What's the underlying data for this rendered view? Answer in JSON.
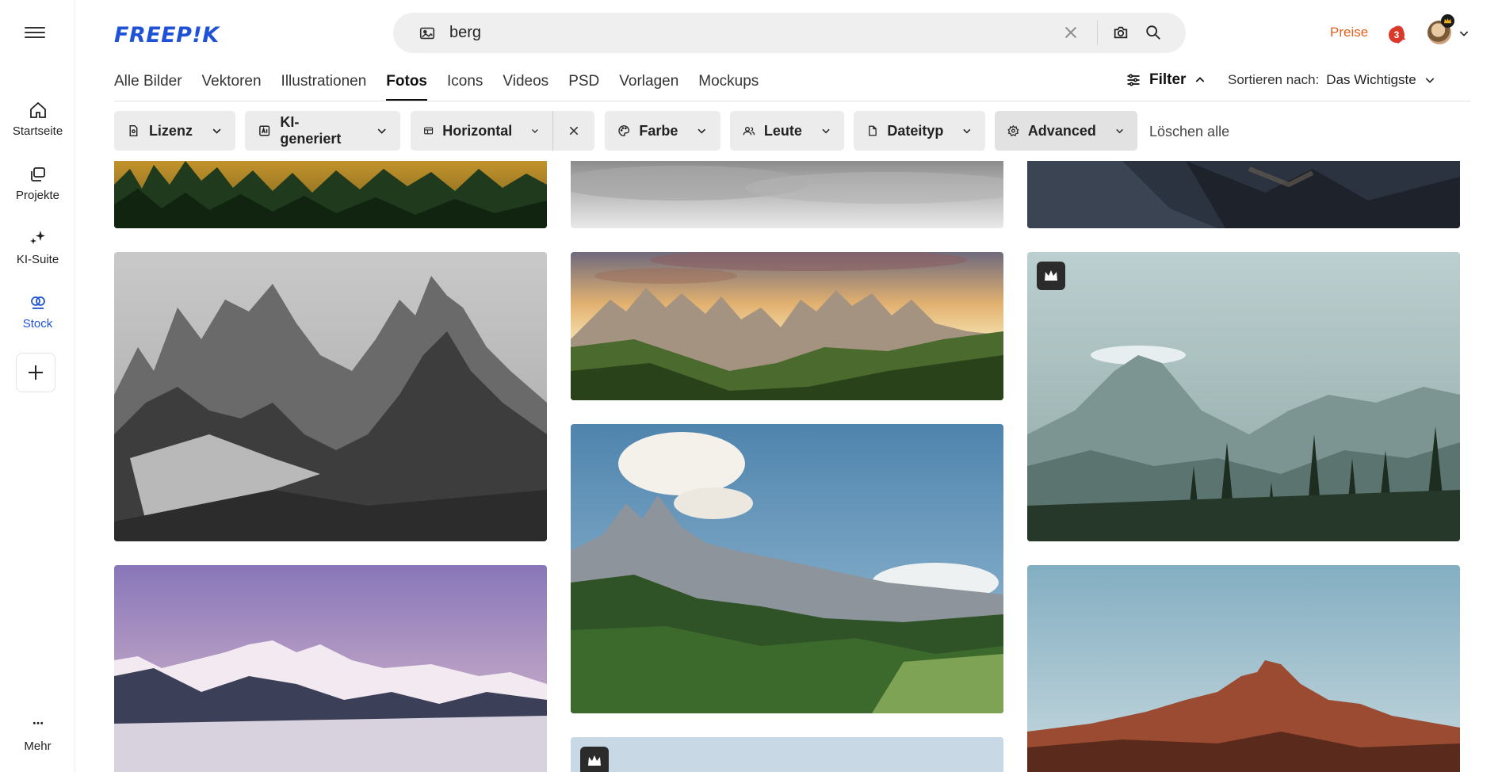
{
  "brand": {
    "logo_text": "FREEP!K",
    "accent": "#1f52d6"
  },
  "rail": {
    "items": [
      {
        "label": "Startseite",
        "icon": "home-icon"
      },
      {
        "label": "Projekte",
        "icon": "projects-icon"
      },
      {
        "label": "KI-Suite",
        "icon": "sparkles-icon"
      },
      {
        "label": "Stock",
        "icon": "stock-icon",
        "active": true
      }
    ],
    "more_label": "Mehr"
  },
  "search": {
    "value": "berg",
    "placeholder": ""
  },
  "header": {
    "pricing_label": "Preise",
    "pricing_color": "#e0621f",
    "notification_count": "3"
  },
  "tabs": [
    {
      "label": "Alle Bilder"
    },
    {
      "label": "Vektoren"
    },
    {
      "label": "Illustrationen"
    },
    {
      "label": "Fotos",
      "active": true
    },
    {
      "label": "Icons"
    },
    {
      "label": "Videos"
    },
    {
      "label": "PSD"
    },
    {
      "label": "Vorlagen"
    },
    {
      "label": "Mockups"
    }
  ],
  "filter_toggle": {
    "label": "Filter"
  },
  "sort": {
    "label": "Sortieren nach:",
    "value": "Das Wichtigste"
  },
  "chips": [
    {
      "label": "Lizenz",
      "icon": "license-icon"
    },
    {
      "label": "KI-generiert",
      "icon": "ai-icon"
    },
    {
      "label": "Horizontal",
      "icon": "layout-icon"
    },
    {
      "label": "Farbe",
      "icon": "palette-icon"
    },
    {
      "label": "Leute",
      "icon": "people-icon"
    },
    {
      "label": "Dateityp",
      "icon": "file-icon"
    },
    {
      "label": "Advanced",
      "icon": "settings-icon"
    }
  ],
  "clear_all_label": "Löschen alle",
  "photos": [
    {
      "name": "forest-hills-photo",
      "premium": false
    },
    {
      "name": "cloud-sea-photo",
      "premium": false
    },
    {
      "name": "dark-ridge-photo",
      "premium": false
    },
    {
      "name": "grey-peaks-photo",
      "premium": false
    },
    {
      "name": "dolomites-sunset-photo",
      "premium": false
    },
    {
      "name": "misty-mountain-forest-photo",
      "premium": true
    },
    {
      "name": "valley-forest-photo",
      "premium": false
    },
    {
      "name": "pink-summit-photo",
      "premium": false
    },
    {
      "name": "red-rock-peak-photo",
      "premium": false
    },
    {
      "name": "bottom-center-photo",
      "premium": true
    }
  ]
}
